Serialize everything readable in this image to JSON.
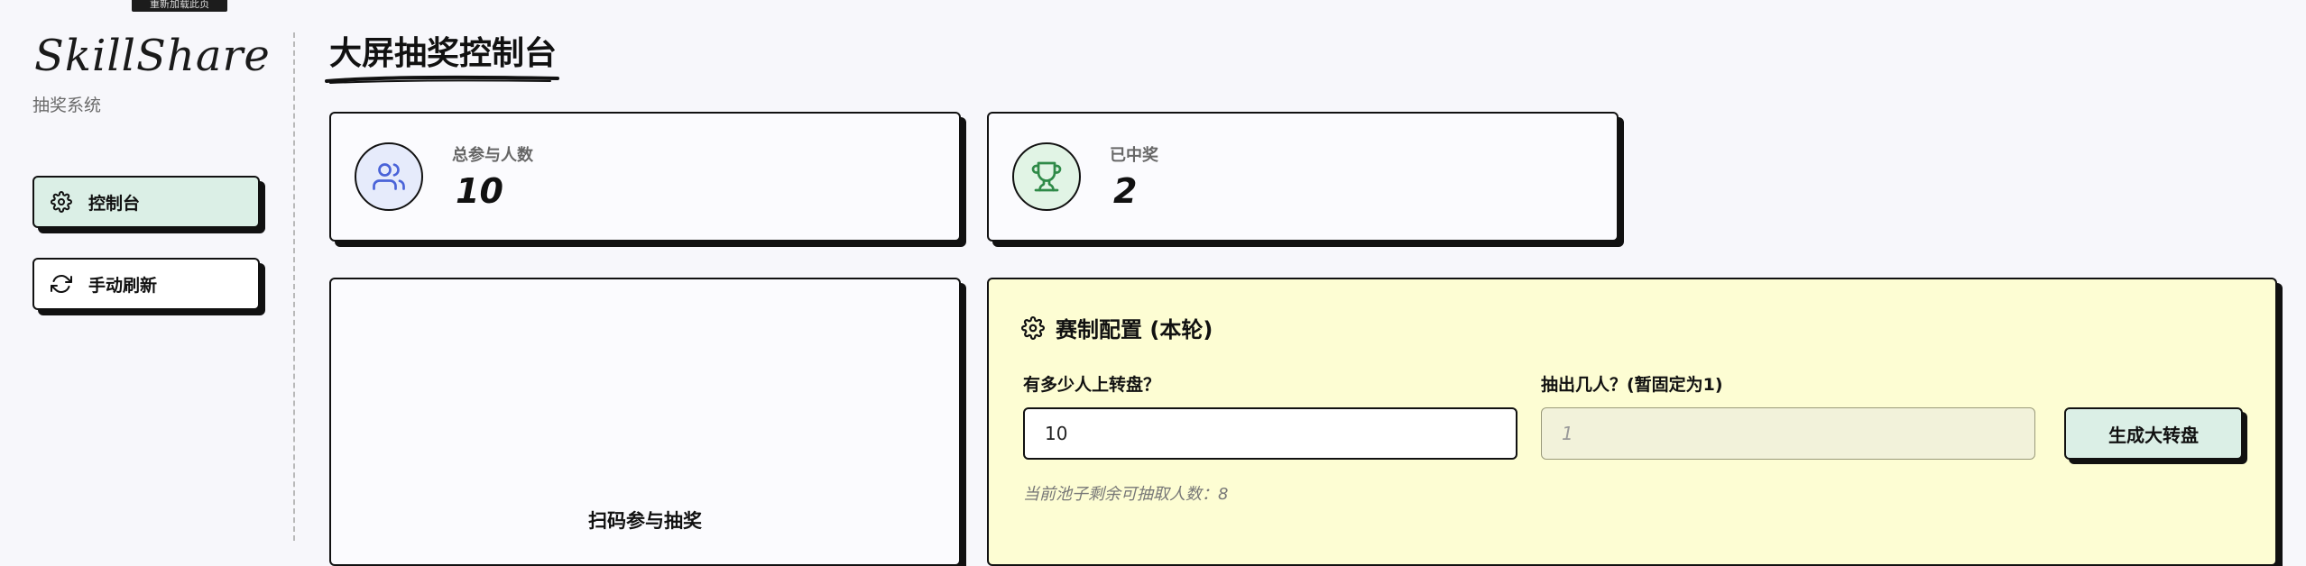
{
  "tooltip": "重新加载此页",
  "sidebar": {
    "brand": "SkillShare",
    "brand_sub": "抽奖系统",
    "items": [
      {
        "label": "控制台",
        "icon": "gear-icon",
        "active": true
      },
      {
        "label": "手动刷新",
        "icon": "refresh-icon",
        "active": false
      }
    ]
  },
  "header": {
    "title": "大屏抽奖控制台"
  },
  "stats": {
    "participants": {
      "label": "总参与人数",
      "value": "10",
      "icon": "users-icon"
    },
    "winners": {
      "label": "已中奖",
      "value": "2",
      "icon": "trophy-icon"
    }
  },
  "qr_panel": {
    "title": "扫码参与抽奖"
  },
  "config": {
    "title": "赛制配置 (本轮)",
    "wheel_label": "有多少人上转盘？",
    "wheel_value": "10",
    "draw_label": "抽出几人？(暂固定为1)",
    "draw_value": "1",
    "generate_label": "生成大转盘",
    "remaining_text": "当前池子剩余可抽取人数：8"
  },
  "colors": {
    "active_nav": "#dbefe6",
    "config_bg": "#fdfdd3",
    "participants_circle": "#e6ebfb",
    "winners_circle": "#e1f4e5"
  }
}
